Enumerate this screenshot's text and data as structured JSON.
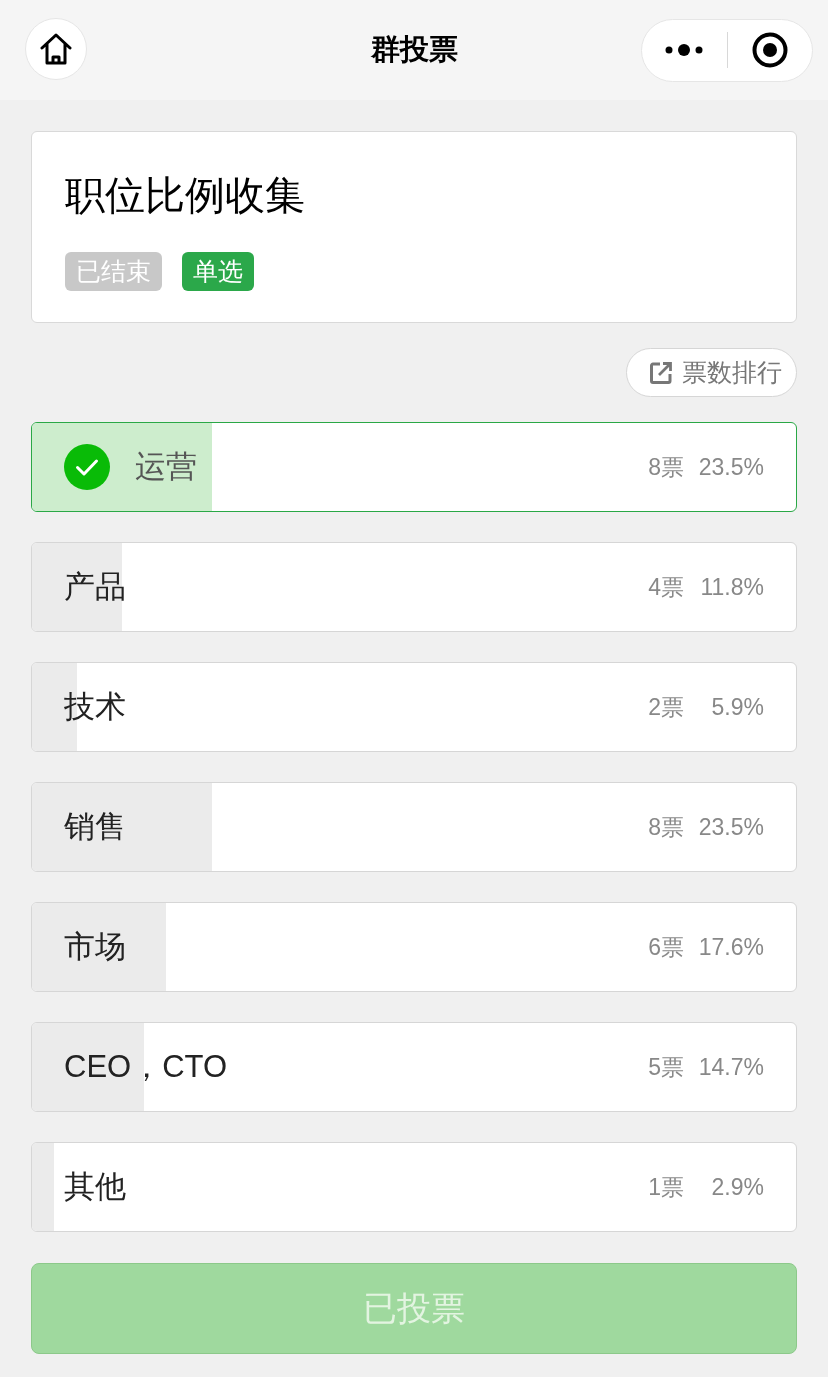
{
  "nav": {
    "title": "群投票"
  },
  "poll": {
    "title": "职位比例收集",
    "tags": [
      {
        "label": "已结束",
        "color": "#c8c8c8"
      },
      {
        "label": "单选",
        "color": "#2ba84a"
      }
    ]
  },
  "rank_button": {
    "label": "票数排行"
  },
  "options": [
    {
      "label": "运营",
      "votes": "8票",
      "percent": "23.5%",
      "level": 0.235,
      "selected": true
    },
    {
      "label": "产品",
      "votes": "4票",
      "percent": "11.8%",
      "level": 0.118,
      "selected": false
    },
    {
      "label": "技术",
      "votes": "2票",
      "percent": "5.9%",
      "level": 0.059,
      "selected": false
    },
    {
      "label": "销售",
      "votes": "8票",
      "percent": "23.5%",
      "level": 0.235,
      "selected": false
    },
    {
      "label": "市场",
      "votes": "6票",
      "percent": "17.6%",
      "level": 0.176,
      "selected": false
    },
    {
      "label": "CEO，CTO",
      "votes": "5票",
      "percent": "14.7%",
      "level": 0.147,
      "selected": false
    },
    {
      "label": "其他",
      "votes": "1票",
      "percent": "2.9%",
      "level": 0.029,
      "selected": false
    }
  ],
  "submit_button": {
    "label": "已投票",
    "disabled": true
  }
}
